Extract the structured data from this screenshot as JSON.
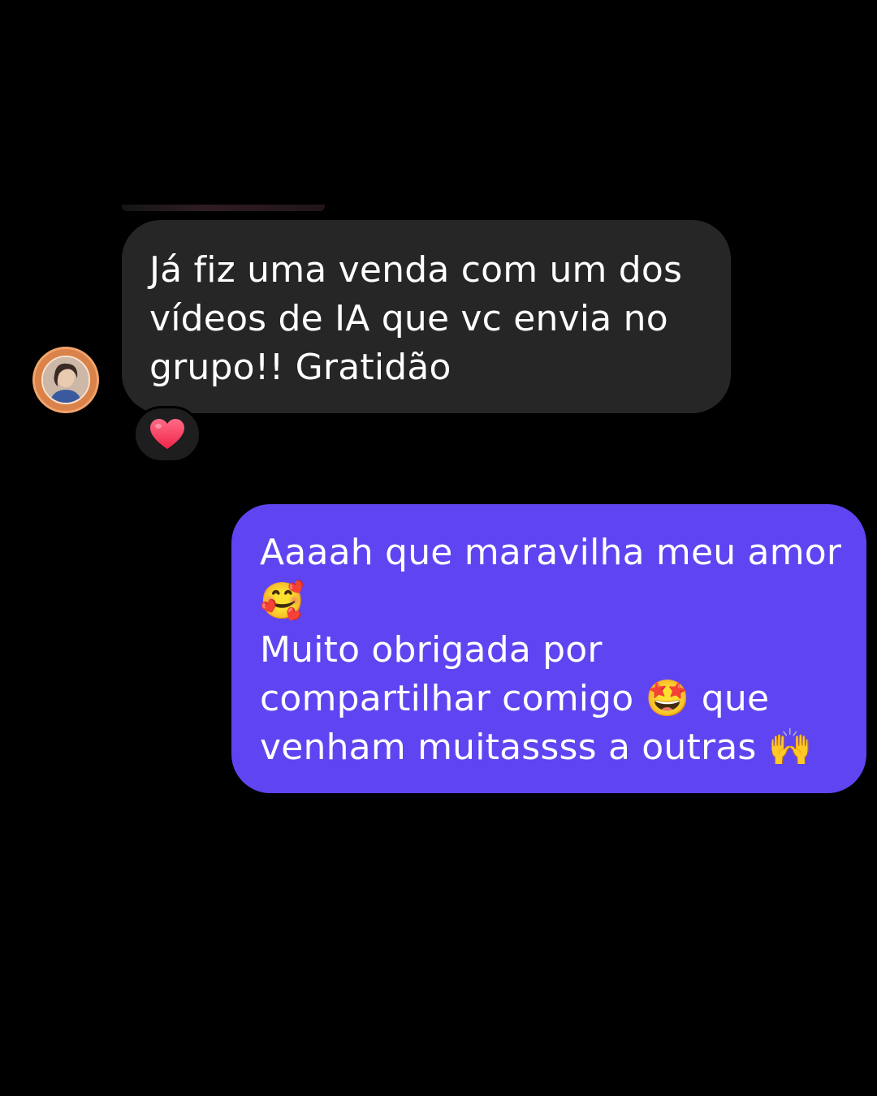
{
  "conversation": {
    "received_message": {
      "lines": [
        "Já fiz uma venda com um dos",
        "vídeos de IA que vc envia no",
        "grupo!! Gratidão"
      ],
      "reaction": "heart"
    },
    "sent_message": {
      "lines": [
        "Aaaah que maravilha meu amor",
        "🥰",
        "Muito obrigada por",
        "compartilhar comigo 🤩 que",
        "venham muitassss a outras 🙌"
      ]
    }
  },
  "colors": {
    "background": "#000000",
    "received_bubble": "#262626",
    "sent_bubble": "#5f45f1",
    "text": "#ffffff",
    "reaction_heart": "#ff3b5c",
    "avatar_ring": "#d9824a"
  },
  "icons": {
    "reaction": "heart-icon",
    "avatar": "profile-avatar"
  }
}
